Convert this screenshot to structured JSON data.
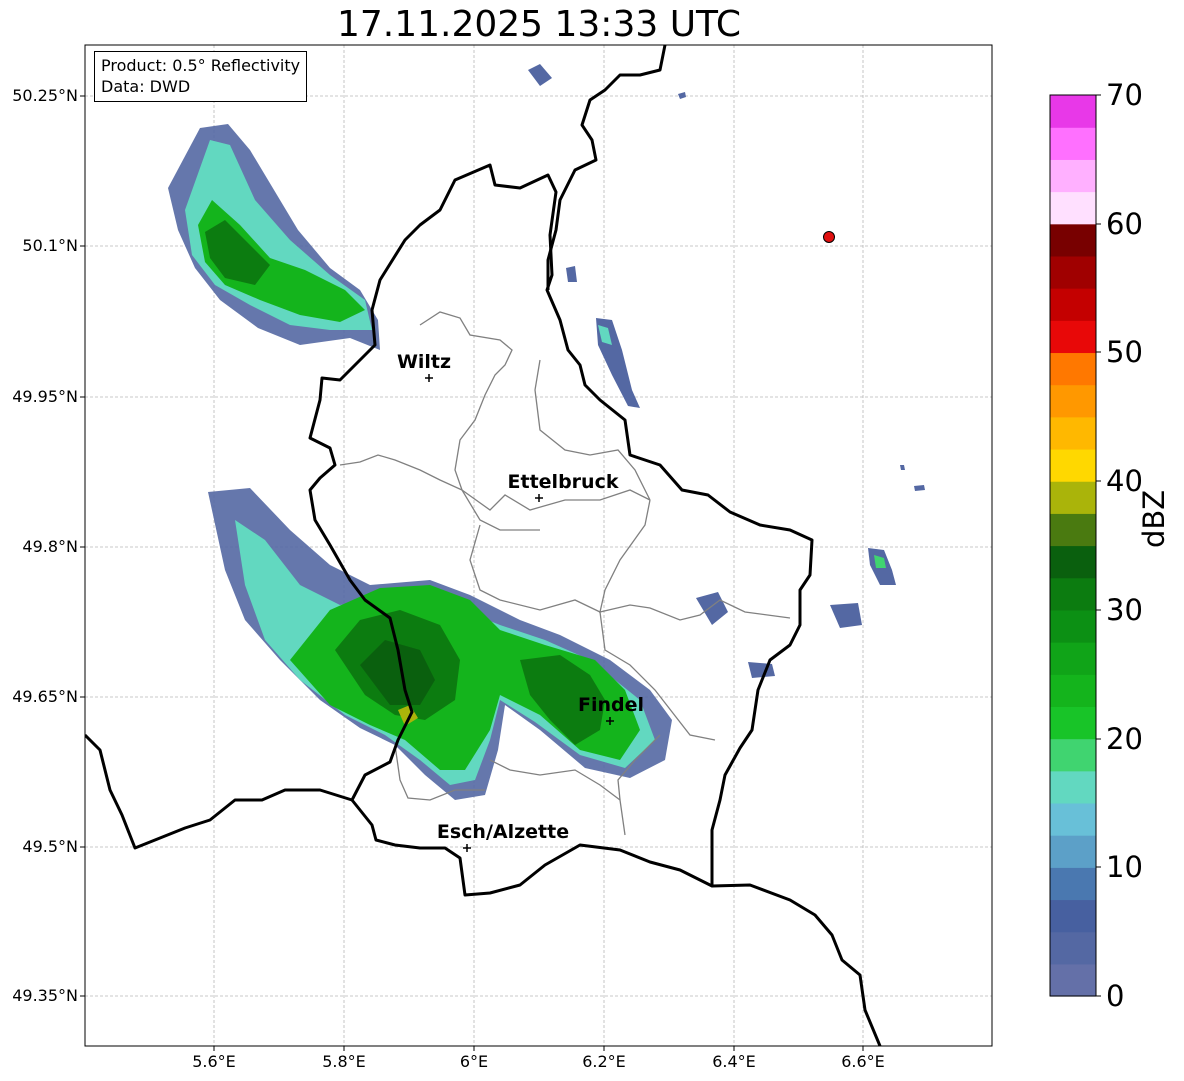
{
  "title": "17.11.2025 13:33 UTC",
  "info": {
    "product": "Product: 0.5° Reflectivity",
    "source": "Data: DWD"
  },
  "axes": {
    "lat_ticks": [
      "50.25°N",
      "50.1°N",
      "49.95°N",
      "49.8°N",
      "49.65°N",
      "49.5°N",
      "49.35°N"
    ],
    "lon_ticks": [
      "5.6°E",
      "5.8°E",
      "6°E",
      "6.2°E",
      "6.4°E",
      "6.6°E"
    ],
    "grid": true
  },
  "cities": [
    {
      "name": "Wiltz"
    },
    {
      "name": "Ettelbruck"
    },
    {
      "name": "Findel"
    },
    {
      "name": "Esch/Alzette"
    }
  ],
  "colorbar": {
    "label": "dBZ",
    "ticks": [
      "0",
      "10",
      "20",
      "30",
      "40",
      "50",
      "60",
      "70"
    ],
    "colors": [
      "#6470a8",
      "#5468a3",
      "#4760a0",
      "#4a78b0",
      "#5ca0c8",
      "#68c0d8",
      "#62d8c0",
      "#40d470",
      "#18c428",
      "#14b41c",
      "#10a418",
      "#0c9014",
      "#0c7c10",
      "#0a600e",
      "#4a7a10",
      "#aab40a",
      "#ffd800",
      "#ffb800",
      "#ff9800",
      "#ff7800",
      "#e80808",
      "#c40000",
      "#a00000",
      "#780000",
      "#ffe0ff",
      "#ffb0ff",
      "#ff70ff",
      "#e838e8"
    ]
  },
  "radar_marker": {
    "color": "#e01010"
  }
}
